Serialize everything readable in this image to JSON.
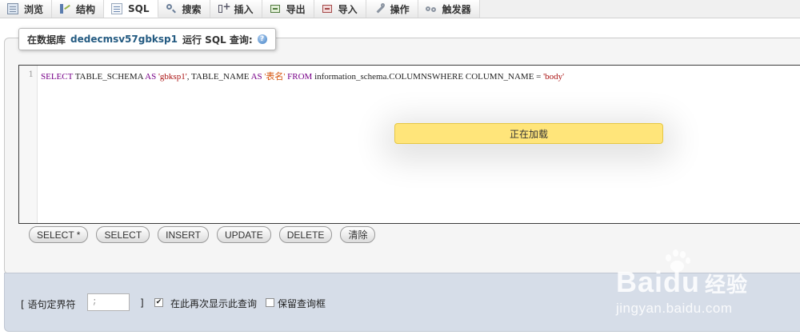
{
  "tabs": [
    {
      "id": "browse",
      "label": "浏览",
      "icon": "browse-icon"
    },
    {
      "id": "structure",
      "label": "结构",
      "icon": "structure-icon"
    },
    {
      "id": "sql",
      "label": "SQL",
      "icon": "sql-icon",
      "active": true
    },
    {
      "id": "search",
      "label": "搜索",
      "icon": "search-icon"
    },
    {
      "id": "insert",
      "label": "插入",
      "icon": "insert-icon"
    },
    {
      "id": "export",
      "label": "导出",
      "icon": "export-icon"
    },
    {
      "id": "import",
      "label": "导入",
      "icon": "import-icon"
    },
    {
      "id": "operations",
      "label": "操作",
      "icon": "wrench-icon"
    },
    {
      "id": "triggers",
      "label": "触发器",
      "icon": "trigger-icon"
    }
  ],
  "query_box": {
    "prefix": "在数据库",
    "database": "dedecmsv57gbksp1",
    "suffix": "运行 SQL 查询:",
    "help_icon": "help-icon"
  },
  "editor": {
    "line_number": "1",
    "tokens": {
      "t1": "SELECT",
      "t2": " TABLE_SCHEMA ",
      "t3": "AS",
      "t4": " 'gbksp1'",
      "t5": ", TABLE_NAME ",
      "t6": "AS",
      "t7": " '表名'",
      "t8": " FROM",
      "t9": " information_schema.COLUMNSWHERE COLUMN_NAME = ",
      "t10": "'body'"
    }
  },
  "loading_text": "正在加载",
  "sql_buttons": [
    "SELECT *",
    "SELECT",
    "INSERT",
    "UPDATE",
    "DELETE",
    "清除"
  ],
  "footer": {
    "delimiter_label": "[ 语句定界符",
    "delimiter_value": ";",
    "delimiter_close": "]",
    "show_again_label": "在此再次显示此查询",
    "show_again_checked": true,
    "retain_label": "保留查询框",
    "retain_checked": false
  },
  "watermark": {
    "brand": "Baidu",
    "brand_zh": "经验",
    "url": "jingyan.baidu.com"
  }
}
